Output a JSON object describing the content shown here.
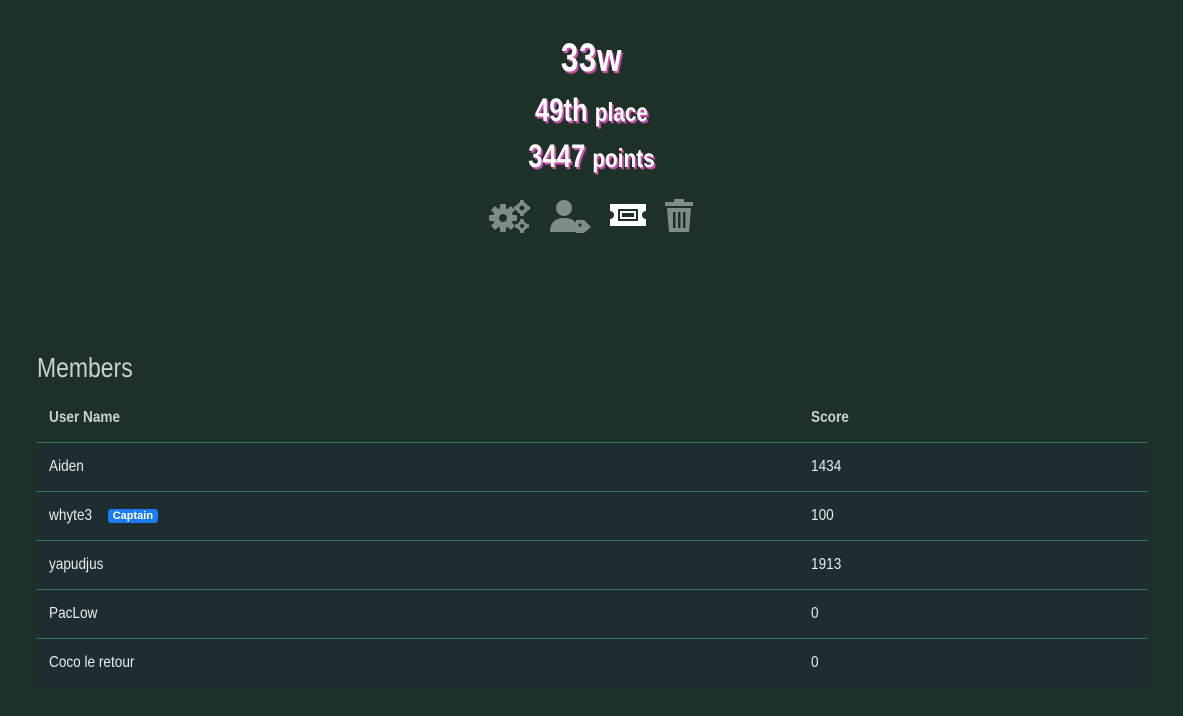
{
  "team": {
    "name": "33w",
    "place_number": "49th",
    "place_suffix": "place",
    "points_number": "3447",
    "points_suffix": "points"
  },
  "toolbar": {
    "icons": [
      "gears-icon",
      "user-tag-icon",
      "ticket-icon",
      "trash-icon"
    ]
  },
  "members": {
    "title": "Members",
    "columns": [
      "User Name",
      "Score"
    ],
    "rows": [
      {
        "name": "Aiden",
        "score": "1434",
        "badge": ""
      },
      {
        "name": "whyte3",
        "score": "100",
        "badge": "Captain"
      },
      {
        "name": "yapudjus",
        "score": "1913",
        "badge": ""
      },
      {
        "name": "PacLow",
        "score": "0",
        "badge": ""
      },
      {
        "name": "Coco le retour",
        "score": "0",
        "badge": ""
      }
    ]
  },
  "colors": {
    "background": "#1d3129",
    "row_background": "#1d2d31",
    "row_border": "#2f7a63",
    "badge": "#1a7cf0",
    "icon": "#7f8d88",
    "accent_shadow": "#d14cb0"
  }
}
